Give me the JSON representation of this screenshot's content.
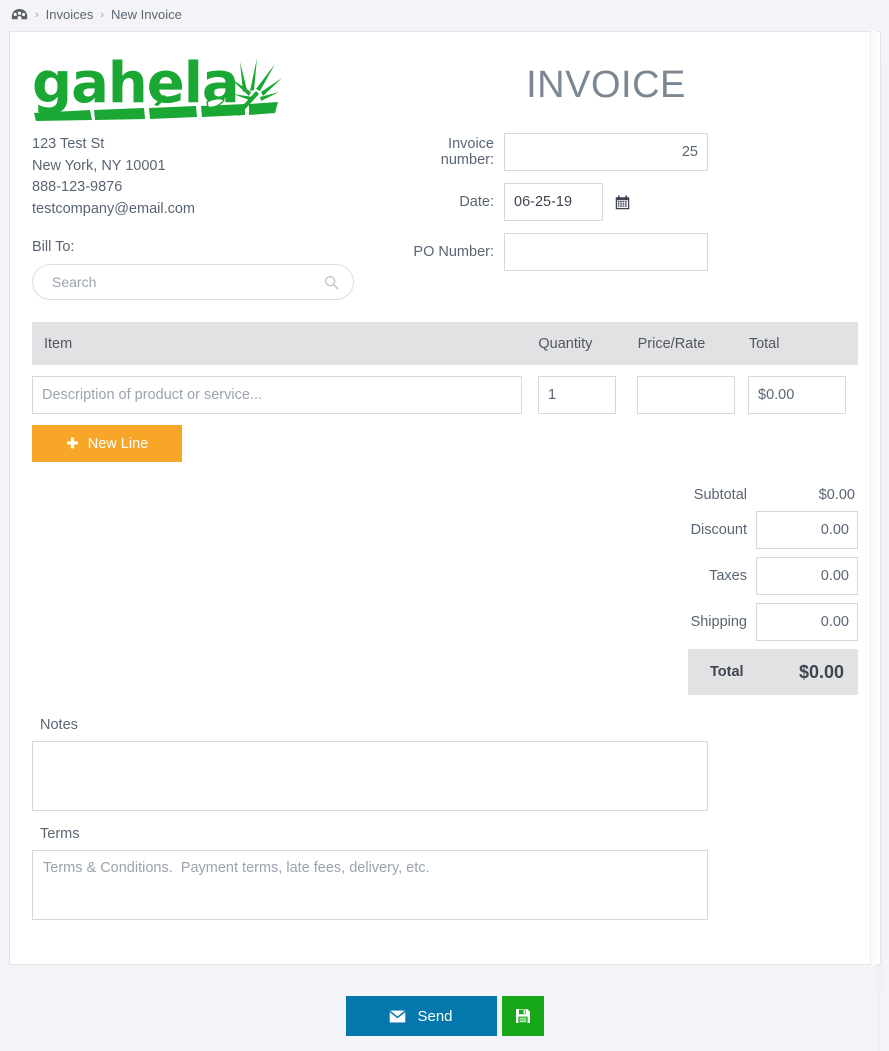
{
  "breadcrumb": {
    "home_icon": "dashboard-icon",
    "separator": "›",
    "items": [
      {
        "label": "Invoices"
      },
      {
        "label": "New Invoice"
      }
    ]
  },
  "company": {
    "logo_text": "gahela",
    "logo_color": "#1aa733",
    "address_lines": [
      "123 Test St",
      "New York, NY 10001",
      "888-123-9876",
      "testcompany@email.com"
    ]
  },
  "bill_to": {
    "label": "Bill To:",
    "search_placeholder": "Search",
    "search_value": "",
    "search_icon": "search-icon"
  },
  "invoice_meta": {
    "title": "INVOICE",
    "fields": [
      {
        "label": "Invoice number:",
        "value": "25",
        "placeholder": ""
      },
      {
        "label": "Date:",
        "value": "06-25-19",
        "placeholder": ""
      },
      {
        "label": "PO Number:",
        "value": "",
        "placeholder": ""
      }
    ],
    "calendar_icon": "calendar-icon"
  },
  "items_table": {
    "columns": [
      "Item",
      "Quantity",
      "Price/Rate",
      "Total"
    ],
    "rows": [
      {
        "description": "",
        "description_placeholder": "Description of product or service...",
        "quantity": "1",
        "price": "",
        "price_placeholder": "",
        "total": "$0.00"
      }
    ],
    "new_line_label": "New Line",
    "new_line_icon": "plus-icon",
    "new_line_color": "#f8a628"
  },
  "totals": {
    "subtotal_label": "Subtotal",
    "subtotal_value": "$0.00",
    "discount_label": "Discount",
    "discount_value": "0.00",
    "taxes_label": "Taxes",
    "taxes_value": "0.00",
    "shipping_label": "Shipping",
    "shipping_value": "0.00",
    "total_label": "Total",
    "total_value": "$0.00"
  },
  "notes": {
    "label": "Notes",
    "value": "",
    "placeholder": ""
  },
  "terms": {
    "label": "Terms",
    "value": "",
    "placeholder": "Terms & Conditions.  Payment terms, late fees, delivery, etc."
  },
  "footer": {
    "send_label": "Send",
    "send_icon": "mail-icon",
    "send_color": "#0477ad",
    "save_icon": "save-icon",
    "save_color": "#16a818"
  }
}
